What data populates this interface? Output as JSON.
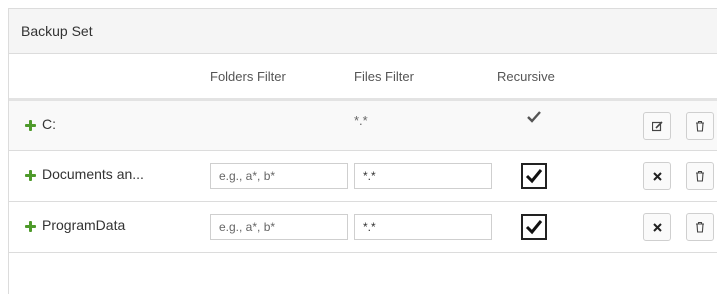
{
  "panel": {
    "title": "Backup Set"
  },
  "columns": {
    "folders_filter": "Folders Filter",
    "files_filter": "Files Filter",
    "recursive": "Recursive"
  },
  "rows": [
    {
      "name": "C:",
      "files_filter": "*.*",
      "recursive": true,
      "editable": false
    },
    {
      "name": "Documents an...",
      "folders_filter_placeholder": "e.g., a*, b*",
      "files_filter_value": "*.*",
      "recursive": true,
      "editable": true
    },
    {
      "name": "ProgramData",
      "folders_filter_placeholder": "e.g., a*, b*",
      "files_filter_value": "*.*",
      "recursive": true,
      "editable": true
    }
  ],
  "icons": {
    "add": "plus-icon",
    "edit": "edit-icon",
    "delete": "trash-icon",
    "cancel": "close-icon",
    "check": "checkmark-icon"
  },
  "colors": {
    "accent_green": "#4e9a2b",
    "header_bg": "#f5f5f5"
  }
}
